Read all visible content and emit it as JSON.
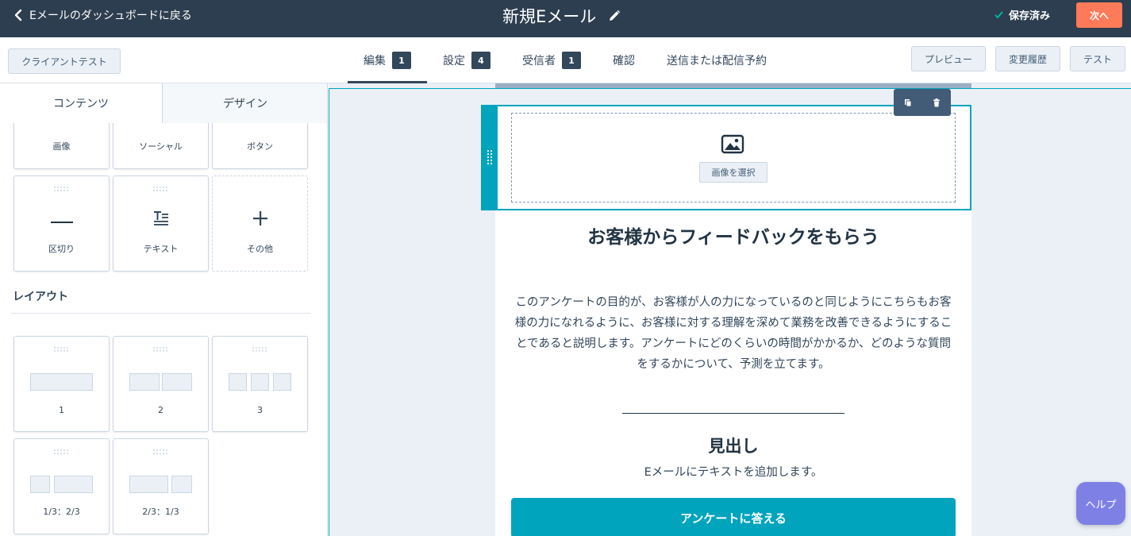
{
  "header": {
    "back_label": "Eメールのダッシュボードに戻る",
    "title": "新規Eメール",
    "saved_label": "保存済み",
    "next_label": "次へ"
  },
  "toolbar": {
    "client_test_label": "クライアントテスト",
    "tabs": [
      {
        "label": "編集",
        "badge": "1",
        "active": true
      },
      {
        "label": "設定",
        "badge": "4",
        "active": false
      },
      {
        "label": "受信者",
        "badge": "1",
        "active": false
      },
      {
        "label": "確認",
        "badge": "",
        "active": false
      },
      {
        "label": "送信または配信予約",
        "badge": "",
        "active": false
      }
    ],
    "preview_label": "プレビュー",
    "history_label": "変更履歴",
    "test_label": "テスト"
  },
  "sidebar": {
    "tabs": [
      {
        "label": "コンテンツ",
        "active": true
      },
      {
        "label": "デザイン",
        "active": false
      }
    ],
    "modules": [
      {
        "label": "画像",
        "icon": "image-icon"
      },
      {
        "label": "ソーシャル",
        "icon": "social-icon"
      },
      {
        "label": "ボタン",
        "icon": "button-cursor-icon"
      },
      {
        "label": "区切り",
        "icon": "divider-icon"
      },
      {
        "label": "テキスト",
        "icon": "text-icon"
      },
      {
        "label": "その他",
        "icon": "plus-icon"
      }
    ],
    "layout_heading": "レイアウト",
    "layouts": [
      {
        "label": "1"
      },
      {
        "label": "2"
      },
      {
        "label": "3"
      },
      {
        "label": "1/3：2/3"
      },
      {
        "label": "2/3：1/3"
      }
    ]
  },
  "canvas": {
    "choose_image_label": "画像を選択",
    "heading": "お客様からフィードバックをもらう",
    "paragraph": "このアンケートの目的が、お客様が人の力になっているのと同じようにこちらもお客様の力になれるように、お客様に対する理解を深めて業務を改善できるようにすることであると説明します。アンケートにどのくらいの時間がかかるか、どのような質問をするかについて、予測を立てます。",
    "subheading": "見出し",
    "subtext": "Eメールにテキストを追加します。",
    "cta_label": "アンケートに答える"
  },
  "help_label": "ヘルプ",
  "colors": {
    "header_bg": "#2d3e50",
    "accent_orange": "#ff7a59",
    "accent_teal": "#00a4bd",
    "help_purple": "#7f80e5"
  }
}
